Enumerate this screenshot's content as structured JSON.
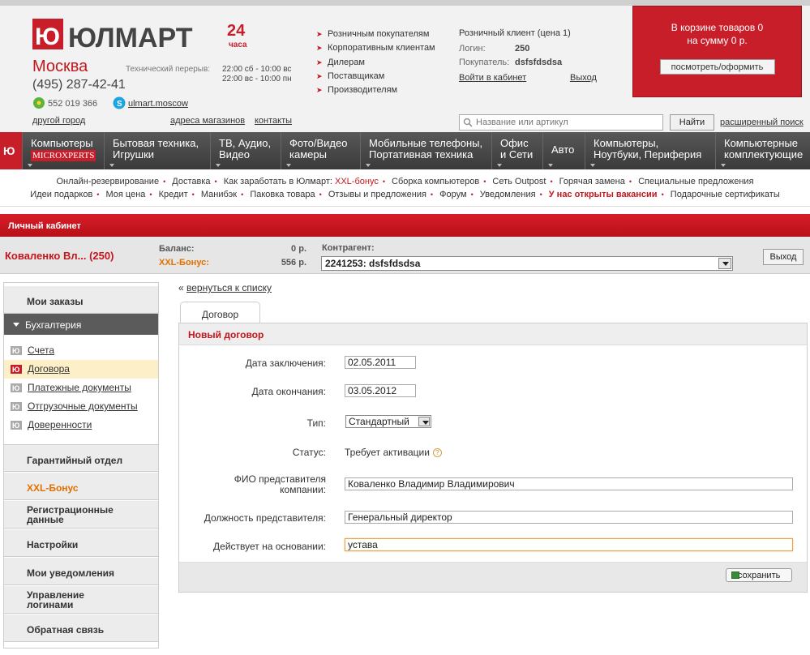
{
  "header": {
    "logo_text": "ЮЛМАРТ",
    "logo_24": "24",
    "logo_hours": "часа",
    "city": "Москва",
    "phone": "(495) 287-42-41",
    "break_label": "Технический перерыв:",
    "break_line1": "22:00 сб - 10:00 вс",
    "break_line2": "22:00 вс - 10:00 пн",
    "icq": "552 019 366",
    "skype": "ulmart.moscow",
    "other_city": "другой город",
    "store_addresses": "адреса магазинов",
    "contacts": "контакты",
    "customer_links": [
      "Розничным покупателям",
      "Корпоративным клиентам",
      "Дилерам",
      "Поставщикам",
      "Производителям"
    ],
    "client_type": "Розничный клиент (цена 1)",
    "login_label": "Логин:",
    "login_value": "250",
    "buyer_label": "Покупатель:",
    "buyer_value": "dsfsfdsdsa",
    "enter_cabinet": "Войти в кабинет",
    "exit": "Выход"
  },
  "cart": {
    "line1": "В корзине товаров 0",
    "line2": "на сумму 0 р.",
    "button": "посмотреть/оформить"
  },
  "search": {
    "placeholder": "Название или артикул",
    "button": "Найти",
    "advanced": "расширенный поиск"
  },
  "nav": [
    {
      "l1": "Компьютеры",
      "l2": "MICROXPERTS"
    },
    {
      "l1": "Бытовая техника,",
      "l2": "Игрушки"
    },
    {
      "l1": "ТВ, Аудио,",
      "l2": "Видео"
    },
    {
      "l1": "Фото/Видео",
      "l2": "камеры"
    },
    {
      "l1": "Мобильные телефоны,",
      "l2": "Портативная техника"
    },
    {
      "l1": "Офис",
      "l2": "и Сети"
    },
    {
      "l1": "Авто",
      "l2": ""
    },
    {
      "l1": "Компьютеры,",
      "l2": "Ноутбуки, Периферия"
    },
    {
      "l1": "Компьютерные",
      "l2": "комплектующие"
    }
  ],
  "sublinks_row1": [
    "Онлайн-резервирование",
    "Доставка",
    "Как заработать в Юлмарт:",
    "XXL-бонус",
    "Сборка компьютеров",
    "Сеть Outpost",
    "Горячая замена",
    "Специальные предложения"
  ],
  "sublinks_row2": [
    "Идеи подарков",
    "Моя цена",
    "Кредит",
    "Манибэк",
    "Паковка товара",
    "Отзывы и предложения",
    "Форум",
    "Уведомления",
    "У нас открыты вакансии",
    "Подарочные сертификаты"
  ],
  "cabinet_title": "Личный кабинет",
  "account": {
    "name": "Коваленко Вл... (250)",
    "balance_label": "Баланс:",
    "balance_value": "0 р.",
    "bonus_label": "XXL-Бонус:",
    "bonus_value": "556 р.",
    "contractor_label": "Контрагент:",
    "contractor_value": "2241253: dsfsfdsdsa",
    "logout": "Выход"
  },
  "sidebar": {
    "my_orders": "Мои заказы",
    "accounting": "Бухгалтерия",
    "sub": [
      "Счета",
      "Договора",
      "Платежные документы",
      "Отгрузочные документы",
      "Доверенности"
    ],
    "warranty": "Гарантийный отдел",
    "xxl": "XXL-Бонус",
    "reg_1": "Регистрационные",
    "reg_2": "данные",
    "settings": "Настройки",
    "notifications": "Мои уведомления",
    "logins_1": "Управление",
    "logins_2": "логинами",
    "feedback": "Обратная связь"
  },
  "content": {
    "back": "вернуться к списку",
    "tab": "Договор",
    "title": "Новый договор",
    "date_conclusion_label": "Дата заключения:",
    "date_conclusion": "02.05.2011",
    "date_end_label": "Дата окончания:",
    "date_end": "03.05.2012",
    "type_label": "Тип:",
    "type_value": "Стандартный",
    "status_label": "Статус:",
    "status_value": "Требует активации",
    "fio_label_1": "ФИО представителя",
    "fio_label_2": "компании:",
    "fio_value": "Коваленко Владимир Владимирович",
    "position_label": "Должность представителя:",
    "position_value": "Генеральный директор",
    "basis_label": "Действует на основании:",
    "basis_value": "устава",
    "save": "сохранить"
  },
  "colors": {
    "brand_red": "#c4161c",
    "bonus_orange": "#e07000",
    "nav_dark": "#3a3a3a"
  }
}
